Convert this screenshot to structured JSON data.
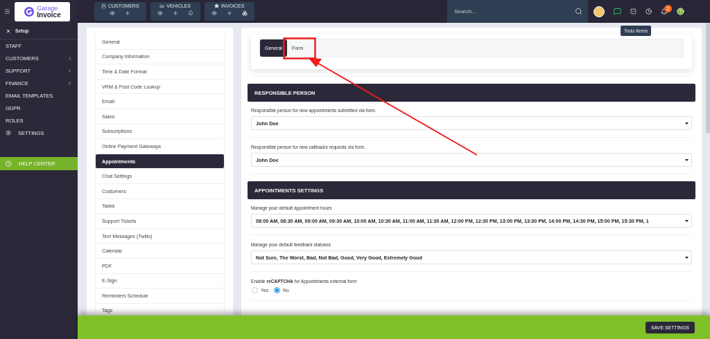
{
  "logo": {
    "line_1": "Garage",
    "line_2": "Invoice"
  },
  "top_nav": [
    {
      "label": "CUSTOMERS",
      "kind": "customers",
      "actions": [
        {
          "kind": "view"
        },
        {
          "kind": "add"
        }
      ]
    },
    {
      "label": "VEHICLES",
      "kind": "vehicles",
      "actions": [
        {
          "kind": "view"
        },
        {
          "kind": "add"
        },
        {
          "kind": "alert"
        }
      ]
    },
    {
      "label": "INVOICES",
      "kind": "invoices",
      "actions": [
        {
          "kind": "view"
        },
        {
          "kind": "add"
        },
        {
          "kind": "group"
        }
      ]
    }
  ],
  "search": {
    "placeholder": "Search..."
  },
  "notifications": {
    "badge": "2"
  },
  "tooltip": "Todo Items",
  "sidebar": {
    "setup_label": "Setup",
    "items": [
      {
        "label": "STAFF",
        "kind": "plain"
      },
      {
        "label": "CUSTOMERS",
        "kind": "submenu"
      },
      {
        "label": "SUPPORT",
        "kind": "submenu"
      },
      {
        "label": "FINANCE",
        "kind": "submenu"
      },
      {
        "label": "EMAIL TEMPLATES",
        "kind": "plain"
      },
      {
        "label": "GDPR",
        "kind": "plain"
      },
      {
        "label": "ROLES",
        "kind": "plain"
      },
      {
        "label": "SETTINGS",
        "kind": "gear"
      }
    ],
    "help_center": "HELP CENTER"
  },
  "settings_menu": [
    {
      "label": "General",
      "selected": false
    },
    {
      "label": "Company Information",
      "selected": false
    },
    {
      "label": "Time & Date Format",
      "selected": false
    },
    {
      "label": "VRM & Post Code Lookup",
      "selected": false
    },
    {
      "label": "Email",
      "selected": false
    },
    {
      "label": "Sales",
      "selected": false
    },
    {
      "label": "Subscriptions",
      "selected": false
    },
    {
      "label": "Online Payment Gateways",
      "selected": false
    },
    {
      "label": "Appointments",
      "selected": true
    },
    {
      "label": "Chat Settings",
      "selected": false
    },
    {
      "label": "Customers",
      "selected": false
    },
    {
      "label": "Tasks",
      "selected": false
    },
    {
      "label": "Support Tickets",
      "selected": false
    },
    {
      "label": "Text Messages (Twilio)",
      "selected": false
    },
    {
      "label": "Calendar",
      "selected": false
    },
    {
      "label": "PDF",
      "selected": false
    },
    {
      "label": "E-Sign",
      "selected": false
    },
    {
      "label": "Reminders Schedule",
      "selected": false
    },
    {
      "label": "Tags",
      "selected": false
    }
  ],
  "tabs": [
    {
      "label": "General",
      "selected": true
    },
    {
      "label": "Form",
      "selected": false
    }
  ],
  "sections": [
    {
      "title": "RESPONSIBLE PERSON",
      "fields": [
        {
          "kind": "select",
          "label": "Responsible person for new appointments submitted via form.",
          "value": "John Doe"
        },
        {
          "kind": "select",
          "label": "Responsible person for new callbacks requests via form.",
          "value": "John Doe"
        }
      ]
    },
    {
      "title": "APPOINTMENTS SETTINGS",
      "fields": [
        {
          "kind": "select",
          "label": "Manage your default appointment hours",
          "value": "08:00 AM, 08:30 AM, 09:00 AM, 09:30 AM, 10:00 AM, 10:30 AM, 11:00 AM, 11:30 AM, 12:00 PM, 12:30 PM, 13:00 PM, 13:30 PM, 14:00 PM, 14:30 PM, 15:00 PM, 15:30 PM, 1"
        },
        {
          "kind": "select",
          "label": "Manage your default feedback statuses",
          "value": "Not Sure, The Worst, Bad, Not Bad, Good, Very Good, Extremely Good"
        },
        {
          "kind": "radio",
          "label": "Enable **reCAPTCHA** for Appointments external form",
          "options": [
            {
              "label": "Yes",
              "selected": false
            },
            {
              "label": "No",
              "selected": true
            }
          ]
        }
      ]
    }
  ],
  "save_button": "SAVE SETTINGS"
}
